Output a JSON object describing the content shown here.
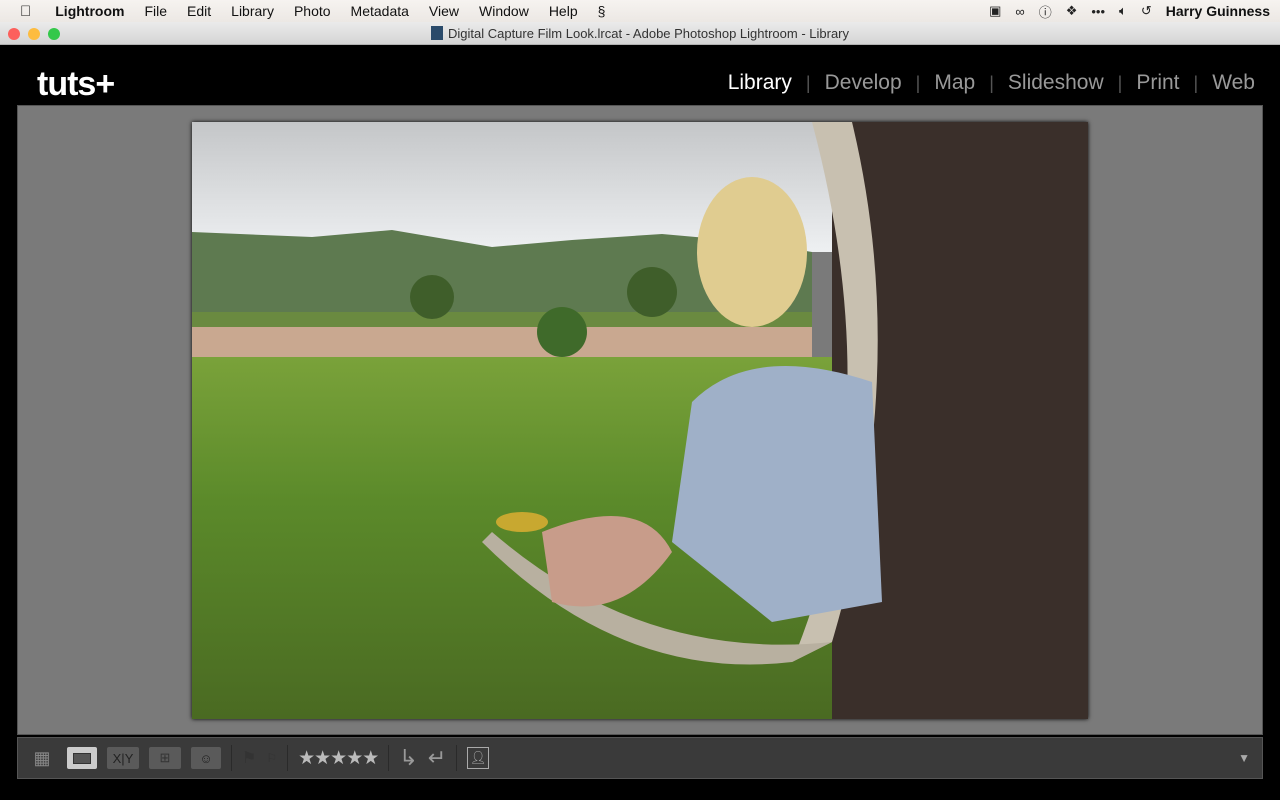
{
  "menubar": {
    "app": "Lightroom",
    "items": [
      "File",
      "Edit",
      "Library",
      "Photo",
      "Metadata",
      "View",
      "Window",
      "Help"
    ],
    "user": "Harry Guinness"
  },
  "window": {
    "title": "Digital Capture Film Look.lrcat - Adobe Photoshop Lightroom - Library"
  },
  "brand": {
    "logo": "tuts+"
  },
  "modules": [
    {
      "label": "Library",
      "active": true
    },
    {
      "label": "Develop"
    },
    {
      "label": "Map"
    },
    {
      "label": "Slideshow"
    },
    {
      "label": "Print"
    },
    {
      "label": "Web"
    }
  ],
  "toolbar": {
    "compare_label": "X|Y",
    "stars": "★★★★★"
  }
}
